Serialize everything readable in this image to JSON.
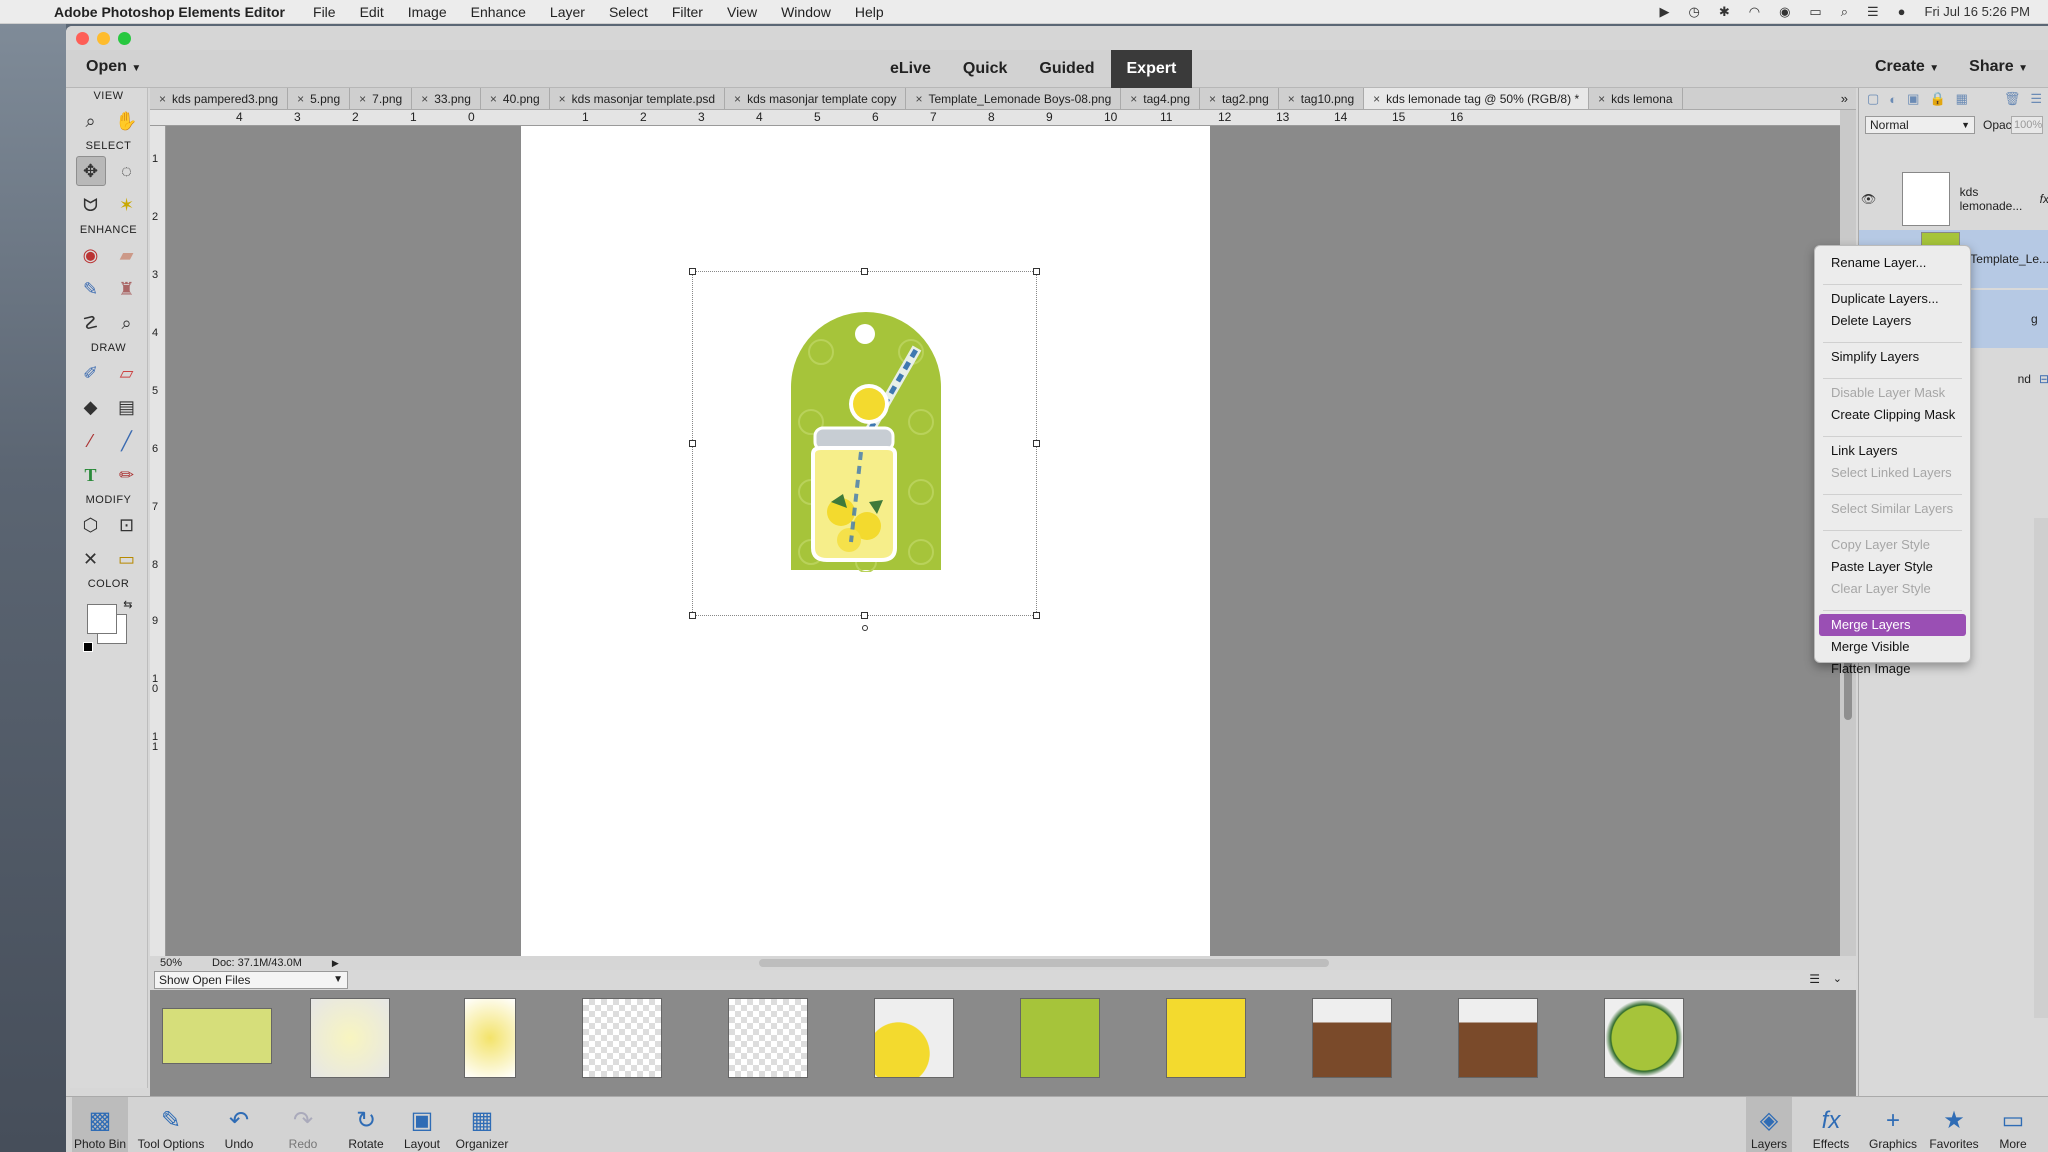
{
  "menubar": {
    "app_name": "Adobe Photoshop Elements Editor",
    "items": [
      "File",
      "Edit",
      "Image",
      "Enhance",
      "Layer",
      "Select",
      "Filter",
      "View",
      "Window",
      "Help"
    ],
    "clock": "Fri Jul 16  5:26 PM"
  },
  "modebar": {
    "open_label": "Open",
    "modes": [
      "eLive",
      "Quick",
      "Guided",
      "Expert"
    ],
    "create_label": "Create",
    "share_label": "Share"
  },
  "toolbox": {
    "view": "VIEW",
    "select": "SELECT",
    "enhance": "ENHANCE",
    "draw": "DRAW",
    "modify": "MODIFY",
    "color": "COLOR"
  },
  "tabs": [
    "kds pampered3.png",
    "5.png",
    "7.png",
    "33.png",
    "40.png",
    "kds masonjar template.psd",
    "kds masonjar template copy",
    "Template_Lemonade Boys-08.png",
    "tag4.png",
    "tag2.png",
    "tag10.png",
    "kds lemonade tag @ 50% (RGB/8) *",
    "kds lemona"
  ],
  "ruler": {
    "top": [
      "4",
      "3",
      "2",
      "1",
      "0",
      "1",
      "2",
      "3",
      "4",
      "5",
      "6",
      "7",
      "8",
      "9",
      "10",
      "11",
      "12",
      "13",
      "14",
      "15",
      "16"
    ],
    "left": [
      "1",
      "2",
      "3",
      "4",
      "5",
      "6",
      "7",
      "8",
      "9",
      "10",
      "11"
    ]
  },
  "status": {
    "zoom": "50%",
    "doc": "Doc: 37.1M/43.0M"
  },
  "bin": {
    "select_label": "Show Open Files"
  },
  "taskbar": {
    "photo_bin": "Photo Bin",
    "tool_options": "Tool Options",
    "undo": "Undo",
    "redo": "Redo",
    "rotate": "Rotate",
    "layout": "Layout",
    "organizer": "Organizer",
    "layers": "Layers",
    "effects": "Effects",
    "graphics": "Graphics",
    "favorites": "Favorites",
    "more": "More"
  },
  "layers_panel": {
    "blend_mode": "Normal",
    "opacity_label": "Opacity:",
    "opacity_value": "100%",
    "layer1": "kds lemonade...",
    "layer2": "Template_Le...",
    "layer3_partial": "g",
    "layer4_partial": "nd"
  },
  "context_menu": {
    "rename": "Rename Layer...",
    "duplicate": "Duplicate Layers...",
    "delete": "Delete Layers",
    "simplify": "Simplify Layers",
    "disable_mask": "Disable Layer Mask",
    "clipping_mask": "Create Clipping Mask",
    "link": "Link Layers",
    "select_linked": "Select Linked Layers",
    "select_similar": "Select Similar Layers",
    "copy_style": "Copy Layer Style",
    "paste_style": "Paste Layer Style",
    "clear_style": "Clear Layer Style",
    "merge": "Merge Layers",
    "merge_visible": "Merge Visible",
    "flatten": "Flatten Image"
  },
  "colors": {
    "accent_highlight": "#9a4fb4",
    "tag_green": "#a6c43a",
    "lemon": "#f3da2e"
  }
}
